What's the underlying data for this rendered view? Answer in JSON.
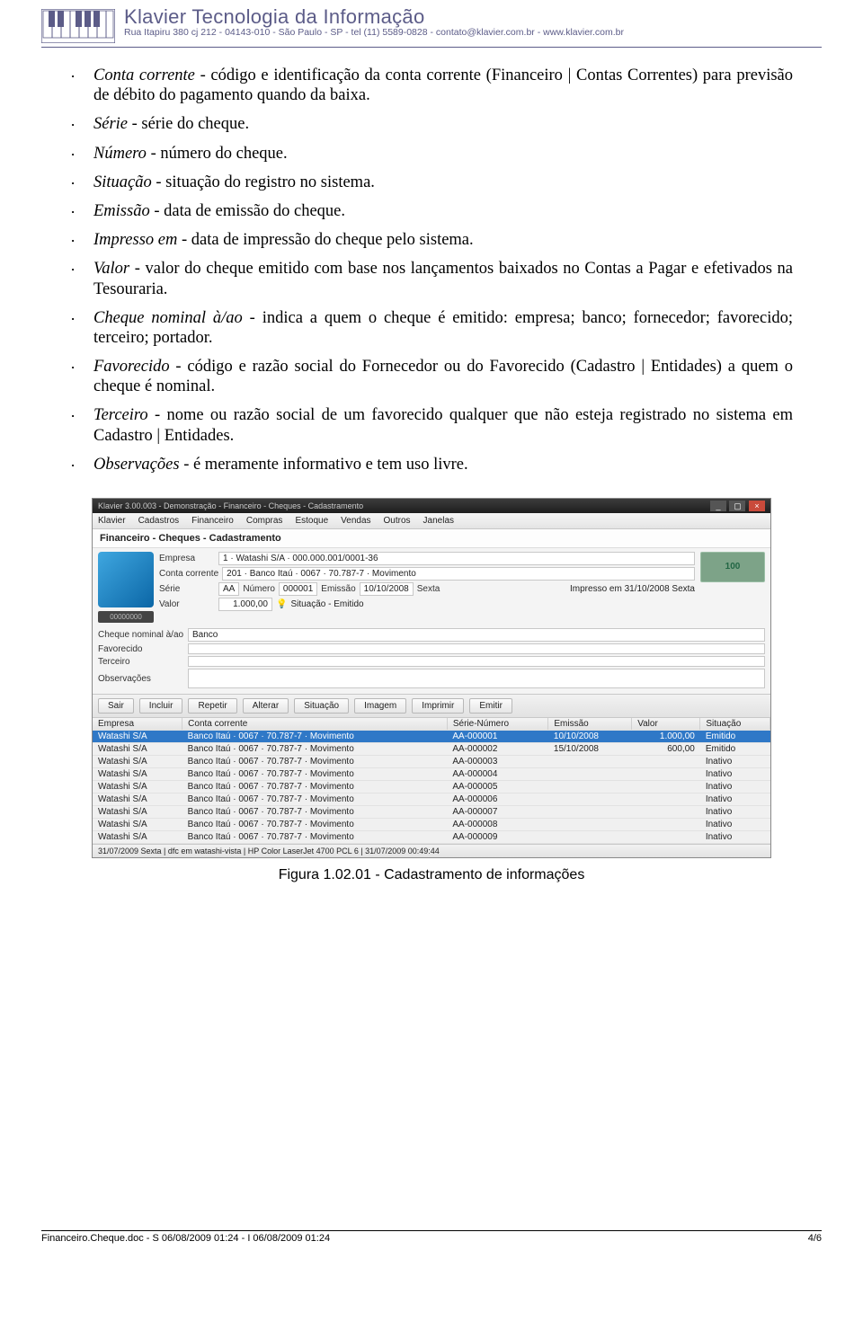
{
  "header": {
    "title": "Klavier Tecnologia da Informação",
    "subtitle": "Rua Itapiru 380 cj 212 - 04143-010 - São Paulo - SP - tel (11) 5589-0828 - contato@klavier.com.br - www.klavier.com.br"
  },
  "bullets": [
    {
      "term": "Conta corrente",
      "rest": " - código e identificação da conta corrente (Financeiro | Contas Correntes) para previsão de débito do pagamento quando da baixa."
    },
    {
      "term": "Série",
      "rest": " - série do cheque."
    },
    {
      "term": "Número",
      "rest": " - número do cheque."
    },
    {
      "term": "Situação",
      "rest": " - situação do registro no sistema."
    },
    {
      "term": "Emissão",
      "rest": " - data de emissão do cheque."
    },
    {
      "term": "Impresso em",
      "rest": " - data de impressão do cheque pelo sistema."
    },
    {
      "term": "Valor",
      "rest": " - valor do cheque emitido com base nos lançamentos baixados no Contas a Pagar e efetivados na Tesouraria."
    },
    {
      "term": "Cheque nominal à/ao",
      "rest": " - indica a quem o cheque é emitido: empresa; banco; fornecedor; favorecido; terceiro; portador."
    },
    {
      "term": "Favorecido",
      "rest": " - código e razão social do Fornecedor ou do Favorecido (Cadastro | Entidades) a quem o cheque é nominal."
    },
    {
      "term": "Terceiro",
      "rest": " - nome ou razão social de um favorecido qualquer que não esteja registrado no sistema em Cadastro | Entidades."
    },
    {
      "term": "Observações",
      "rest": " - é meramente informativo e tem uso livre."
    }
  ],
  "app": {
    "window_title": "Klavier 3.00.003 - Demonstração - Financeiro - Cheques - Cadastramento",
    "menu": [
      "Klavier",
      "Cadastros",
      "Financeiro",
      "Compras",
      "Estoque",
      "Vendas",
      "Outros",
      "Janelas"
    ],
    "breadcrumb": "Financeiro - Cheques - Cadastramento",
    "micro_label": "00000000",
    "form": {
      "empresa_label": "Empresa",
      "empresa_value": "1 · Watashi S/A · 000.000.001/0001-36",
      "conta_label": "Conta corrente",
      "conta_value": "201 · Banco Itaú · 0067 · 70.787-7 · Movimento",
      "serie_label": "Série",
      "serie_value": "AA",
      "numero_label": "Número",
      "numero_value": "000001",
      "emissao_label": "Emissão",
      "emissao_value": "10/10/2008",
      "sexta_label": "Sexta",
      "impresso_label": "Impresso em 31/10/2008 Sexta",
      "valor_label": "Valor",
      "valor_value": "1.000,00",
      "situacao_label": "Situação - Emitido",
      "nominal_label": "Cheque nominal à/ao",
      "nominal_value": "Banco",
      "favorecido_label": "Favorecido",
      "favorecido_value": "",
      "terceiro_label": "Terceiro",
      "terceiro_value": "",
      "obs_label": "Observações",
      "obs_value": ""
    },
    "money_note": "100",
    "toolbar": [
      "Sair",
      "Incluir",
      "Repetir",
      "Alterar",
      "Situação",
      "Imagem",
      "Imprimir",
      "Emitir"
    ],
    "columns": [
      "Empresa",
      "Conta corrente",
      "Série-Número",
      "Emissão",
      "Valor",
      "Situação"
    ],
    "rows": [
      {
        "empresa": "Watashi S/A",
        "conta": "Banco Itaú · 0067 · 70.787-7 · Movimento",
        "sn": "AA-000001",
        "em": "10/10/2008",
        "valor": "1.000,00",
        "sit": "Emitido",
        "sel": true
      },
      {
        "empresa": "Watashi S/A",
        "conta": "Banco Itaú · 0067 · 70.787-7 · Movimento",
        "sn": "AA-000002",
        "em": "15/10/2008",
        "valor": "600,00",
        "sit": "Emitido"
      },
      {
        "empresa": "Watashi S/A",
        "conta": "Banco Itaú · 0067 · 70.787-7 · Movimento",
        "sn": "AA-000003",
        "em": "",
        "valor": "",
        "sit": "Inativo"
      },
      {
        "empresa": "Watashi S/A",
        "conta": "Banco Itaú · 0067 · 70.787-7 · Movimento",
        "sn": "AA-000004",
        "em": "",
        "valor": "",
        "sit": "Inativo"
      },
      {
        "empresa": "Watashi S/A",
        "conta": "Banco Itaú · 0067 · 70.787-7 · Movimento",
        "sn": "AA-000005",
        "em": "",
        "valor": "",
        "sit": "Inativo"
      },
      {
        "empresa": "Watashi S/A",
        "conta": "Banco Itaú · 0067 · 70.787-7 · Movimento",
        "sn": "AA-000006",
        "em": "",
        "valor": "",
        "sit": "Inativo"
      },
      {
        "empresa": "Watashi S/A",
        "conta": "Banco Itaú · 0067 · 70.787-7 · Movimento",
        "sn": "AA-000007",
        "em": "",
        "valor": "",
        "sit": "Inativo"
      },
      {
        "empresa": "Watashi S/A",
        "conta": "Banco Itaú · 0067 · 70.787-7 · Movimento",
        "sn": "AA-000008",
        "em": "",
        "valor": "",
        "sit": "Inativo"
      },
      {
        "empresa": "Watashi S/A",
        "conta": "Banco Itaú · 0067 · 70.787-7 · Movimento",
        "sn": "AA-000009",
        "em": "",
        "valor": "",
        "sit": "Inativo"
      }
    ],
    "statusbar": "31/07/2009 Sexta | dfc em watashi-vista | HP Color LaserJet 4700 PCL 6 | 31/07/2009 00:49:44"
  },
  "figure_caption": "Figura 1.02.01 - Cadastramento de informações",
  "footer": {
    "left": "Financeiro.Cheque.doc - S 06/08/2009 01:24 - I 06/08/2009 01:24",
    "right": "4/6"
  }
}
